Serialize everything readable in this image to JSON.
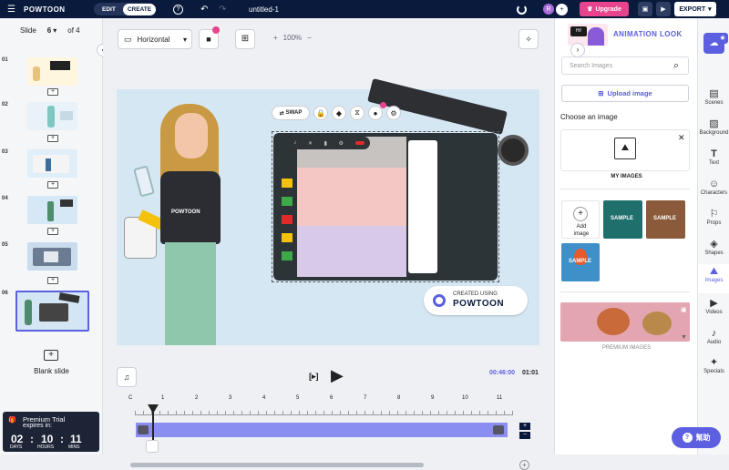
{
  "topbar": {
    "brand": "POWTOON",
    "edit": "EDIT",
    "create": "CREATE",
    "title": "untitled-1",
    "upgrade": "Upgrade",
    "export": "EXPORT",
    "avatar_letter": "R"
  },
  "slides": {
    "label": "Slide",
    "current": "6",
    "of": "of 4",
    "numbers": [
      "01",
      "02",
      "03",
      "04",
      "05",
      "06"
    ],
    "blank": "Blank slide"
  },
  "trial": {
    "title": "Premium Trial",
    "subtitle": "expires in:",
    "days": "02",
    "hours": "10",
    "mins": "11",
    "days_label": "DAYS",
    "hours_label": "HOURS",
    "mins_label": "MINS"
  },
  "canvas_toolbar": {
    "orientation": "Horizontal",
    "zoom": "100%",
    "plus": "+",
    "minus": "−"
  },
  "stage": {
    "swap": "SWAP",
    "created_using": "CREATED USING",
    "powtoon_logo": "POWTOON",
    "shirt_text": "POWTOON"
  },
  "playback": {
    "current_time": "00:46:00",
    "total": "01:01"
  },
  "timeline": {
    "ticks": [
      "C",
      "1",
      "2",
      "3",
      "4",
      "5",
      "6",
      "7",
      "8",
      "9",
      "10",
      "11"
    ]
  },
  "panel": {
    "header": "ANIMATION LOOK",
    "badge": "Hi!",
    "search_placeholder": "Search Images",
    "upload": "Upload image",
    "choose": "Choose an image",
    "my_images": "MY IMAGES",
    "add_image": "Add image",
    "sample": "SAMPLE",
    "premium": "PREMIUM IMAGES"
  },
  "rail": [
    "Scenes",
    "Background",
    "Text",
    "Characters",
    "Props",
    "Shapes",
    "Images",
    "Videos",
    "Audio",
    "Specials"
  ],
  "help": "幫助",
  "colors": {
    "accent": "#5b5fe0",
    "brand_navy": "#0a1a3c",
    "upgrade": "#e8438c",
    "timeline": "#8a8ef0"
  }
}
